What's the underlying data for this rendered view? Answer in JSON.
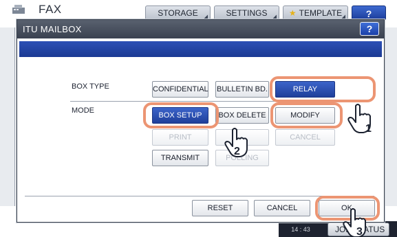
{
  "app": {
    "title": "FAX",
    "icons": {
      "fax": "fax-machine-icon",
      "star": "star-icon",
      "hand": "pointing-hand-icon"
    }
  },
  "top_tabs": {
    "storage": "STORAGE",
    "settings": "SETTINGS",
    "template": "TEMPLATE",
    "help": "?"
  },
  "dialog": {
    "title": "ITU MAILBOX",
    "help": "?",
    "box_type_label": "BOX TYPE",
    "mode_label": "MODE",
    "box_type_options": [
      {
        "label": "CONFIDENTIAL",
        "selected": false
      },
      {
        "label": "BULLETIN BD.",
        "selected": false
      },
      {
        "label": "RELAY",
        "selected": true
      }
    ],
    "mode_options": [
      {
        "label": "BOX SETUP",
        "selected": true
      },
      {
        "label": "BOX DELETE",
        "selected": false
      },
      {
        "label": "MODIFY",
        "selected": false
      }
    ],
    "actions": [
      {
        "label": "PRINT",
        "enabled": false
      },
      {
        "label": "",
        "enabled": false
      },
      {
        "label": "CANCEL",
        "enabled": false
      },
      {
        "label": "TRANSMIT",
        "enabled": true
      },
      {
        "label": "POLLING",
        "enabled": false
      }
    ],
    "footer": {
      "reset": "RESET",
      "cancel": "CANCEL",
      "ok": "OK"
    }
  },
  "status": {
    "date": "",
    "time": "14 : 43",
    "job_status": "JOB STATUS"
  },
  "annotations": {
    "step1": "1",
    "step2": "2",
    "step3": "3",
    "highlight_color": "#ec9573"
  },
  "colors": {
    "selected_button": "#2a4fb0",
    "dialog_bar": "#1c3a93",
    "titlebar": "#4a5261"
  }
}
